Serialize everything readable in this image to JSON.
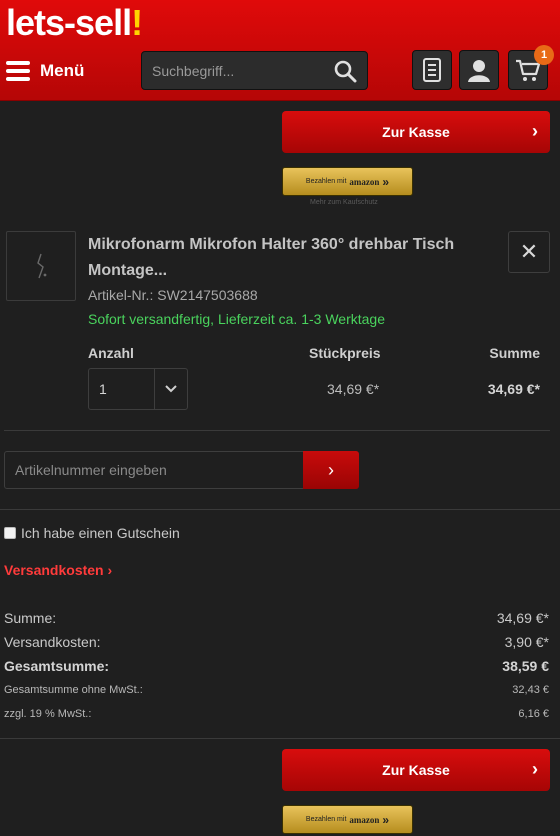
{
  "header": {
    "logo_main": "lets-sell",
    "logo_bang": "!",
    "menu_label": "Menü",
    "search_placeholder": "Suchbegriff...",
    "cart_count": "1"
  },
  "checkout": {
    "button_label": "Zur Kasse",
    "amazon_prefix": "Bezahlen mit",
    "amazon_brand": "amazon",
    "amazon_note": "Mehr zum Kaufschutz"
  },
  "cart_item": {
    "title": "Mikrofonarm Mikrofon Halter 360° drehbar Tisch Montage...",
    "article_number": "Artikel-Nr.: SW2147503688",
    "delivery": "Sofort versandfertig, Lieferzeit ca. 1-3 Werktage",
    "col_qty": "Anzahl",
    "col_unit": "Stückpreis",
    "col_sum": "Summe",
    "quantity": "1",
    "unit_price": "34,69 €*",
    "line_total": "34,69 €*"
  },
  "add_article": {
    "placeholder": "Artikelnummer eingeben"
  },
  "voucher": {
    "label": "Ich habe einen Gutschein",
    "checked": false
  },
  "shipping_link": "Versandkosten",
  "summary": {
    "rows": [
      {
        "label": "Summe:",
        "value": "34,69 €*"
      },
      {
        "label": "Versandkosten:",
        "value": "3,90 €*"
      },
      {
        "label": "Gesamtsumme:",
        "value": "38,59 €"
      },
      {
        "label": "Gesamtsumme ohne MwSt.:",
        "value": "32,43 €"
      },
      {
        "label": "zzgl. 19 % MwSt.:",
        "value": "6,16 €"
      }
    ]
  },
  "colors": {
    "brand_red": "#d80d0d",
    "accent_green": "#4ad35d",
    "badge_orange": "#e86a17"
  }
}
